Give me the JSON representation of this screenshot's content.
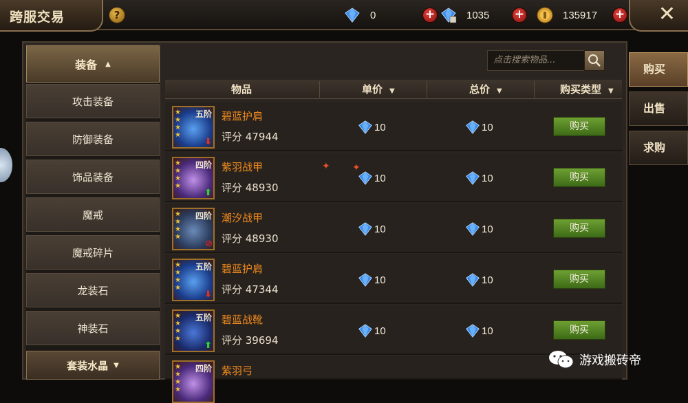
{
  "header": {
    "title": "跨服交易",
    "help_label": "?",
    "currencies": [
      {
        "icon": "diamond-icon",
        "value": "0"
      },
      {
        "icon": "bound-diamond-icon",
        "value": "1035"
      },
      {
        "icon": "gold-coin-icon",
        "value": "135917"
      }
    ],
    "plus_label": "+",
    "close_label": "✕"
  },
  "sidebar": {
    "header": "装备",
    "items": [
      {
        "label": "攻击装备"
      },
      {
        "label": "防御装备"
      },
      {
        "label": "饰品装备"
      },
      {
        "label": "魔戒"
      },
      {
        "label": "魔戒碎片"
      },
      {
        "label": "龙装石"
      },
      {
        "label": "神装石"
      }
    ],
    "footer": "套装水晶"
  },
  "search": {
    "placeholder": "点击搜索物品..."
  },
  "table": {
    "columns": [
      "物品",
      "单价",
      "总价",
      "购买类型"
    ],
    "rows": [
      {
        "name": "碧蓝护肩",
        "score": "评分 47944",
        "tier": "五阶",
        "unit_price": "10",
        "total_price": "10",
        "action": "购买",
        "badge": "down-arrow"
      },
      {
        "name": "紫羽战甲",
        "score": "评分 48930",
        "tier": "四阶",
        "unit_price": "10",
        "total_price": "10",
        "action": "购买",
        "badge": "up-arrow"
      },
      {
        "name": "潮汐战甲",
        "score": "评分 48930",
        "tier": "四阶",
        "unit_price": "10",
        "total_price": "10",
        "action": "购买",
        "badge": "forbidden"
      },
      {
        "name": "碧蓝护肩",
        "score": "评分 47344",
        "tier": "五阶",
        "unit_price": "10",
        "total_price": "10",
        "action": "购买",
        "badge": "down-arrow"
      },
      {
        "name": "碧蓝战靴",
        "score": "评分 39694",
        "tier": "五阶",
        "unit_price": "10",
        "total_price": "10",
        "action": "购买",
        "badge": "up-arrow"
      },
      {
        "name": "紫羽弓",
        "score": "",
        "tier": "四阶",
        "unit_price": "",
        "total_price": "",
        "action": "",
        "badge": ""
      }
    ]
  },
  "right_tabs": [
    {
      "label": "购买",
      "active": true
    },
    {
      "label": "出售",
      "active": false
    },
    {
      "label": "求购",
      "active": false
    }
  ],
  "watermark": {
    "text": "游戏搬砖帝"
  },
  "colors": {
    "item_name": "#f08a1e",
    "buy_button": "#5a8a28",
    "diamond": "#3a8ae8"
  }
}
